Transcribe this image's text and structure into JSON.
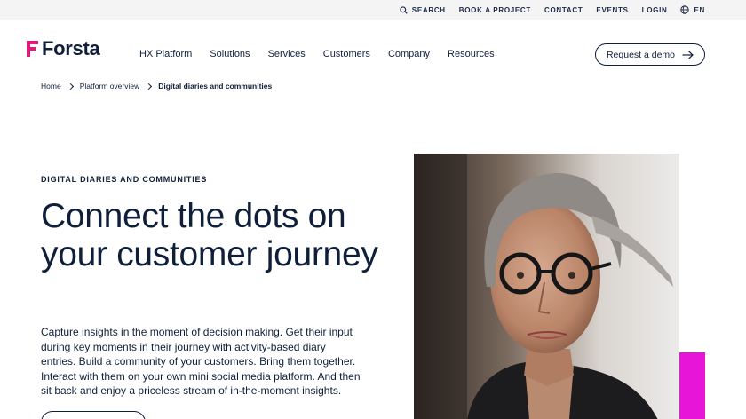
{
  "topnav": {
    "search": "SEARCH",
    "book": "BOOK A PROJECT",
    "contact": "CONTACT",
    "events": "EVENTS",
    "login": "LOGIN",
    "lang": "EN"
  },
  "brand": {
    "name": "Forsta",
    "accent_color": "#e4177c"
  },
  "nav": {
    "items": [
      "HX Platform",
      "Solutions",
      "Services",
      "Customers",
      "Company",
      "Resources"
    ]
  },
  "cta": {
    "demo": "Request a demo"
  },
  "breadcrumb": {
    "home": "Home",
    "parent": "Platform overview",
    "current": "Digital diaries and communities"
  },
  "hero": {
    "eyebrow": "DIGITAL DIARIES AND COMMUNITIES",
    "headline": "Connect the dots on your customer journey",
    "body": "Capture insights in the moment of decision making. Get their input during key moments in their journey with activity-based diary entries. Build a community of your customers. Bring them together. Interact with them on your own mini social media platform. And then sit back and enjoy a priceless stream of in-the-moment insights.",
    "accent_color": "#e615d8"
  }
}
